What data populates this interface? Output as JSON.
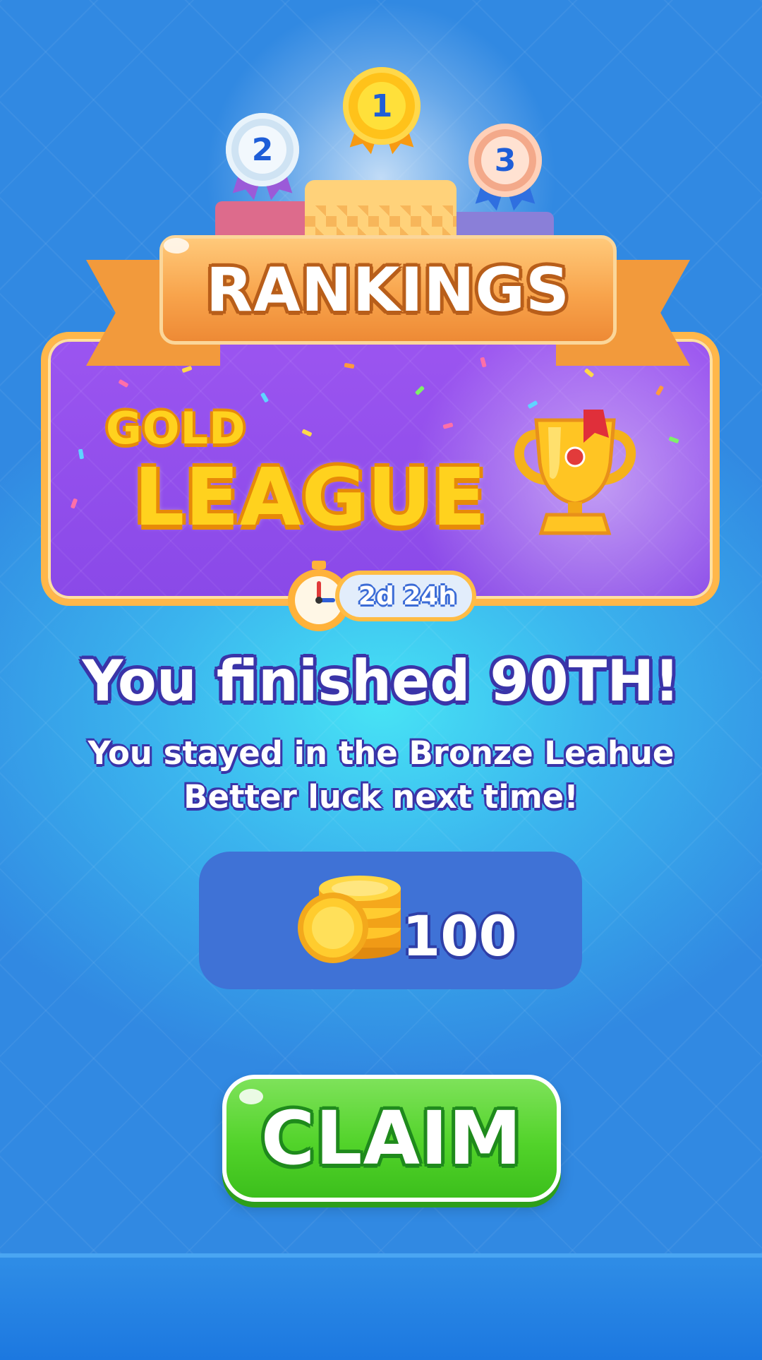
{
  "header": {
    "title": "RANKINGS",
    "medals": [
      {
        "rank": "1",
        "name": "gold"
      },
      {
        "rank": "2",
        "name": "silver"
      },
      {
        "rank": "3",
        "name": "bronze"
      }
    ]
  },
  "league": {
    "word1": "GOLD",
    "word2": "LEAGUE",
    "timer": "2d 24h",
    "icons": {
      "trophy": "trophy-icon",
      "timer": "stopwatch-icon"
    }
  },
  "result": {
    "title": "You finished 90TH!",
    "line1": "You stayed in the Bronze Leahue",
    "line2": "Better luck next time!"
  },
  "reward": {
    "amount": "100",
    "icon": "coin-stack-icon"
  },
  "claim": {
    "label": "CLAIM"
  },
  "colors": {
    "background": "#3bb5ee",
    "banner": "#f8a44c",
    "league_card": "#8a49e8",
    "claim_button": "#52d32a",
    "reward_box": "#3f72d6"
  }
}
